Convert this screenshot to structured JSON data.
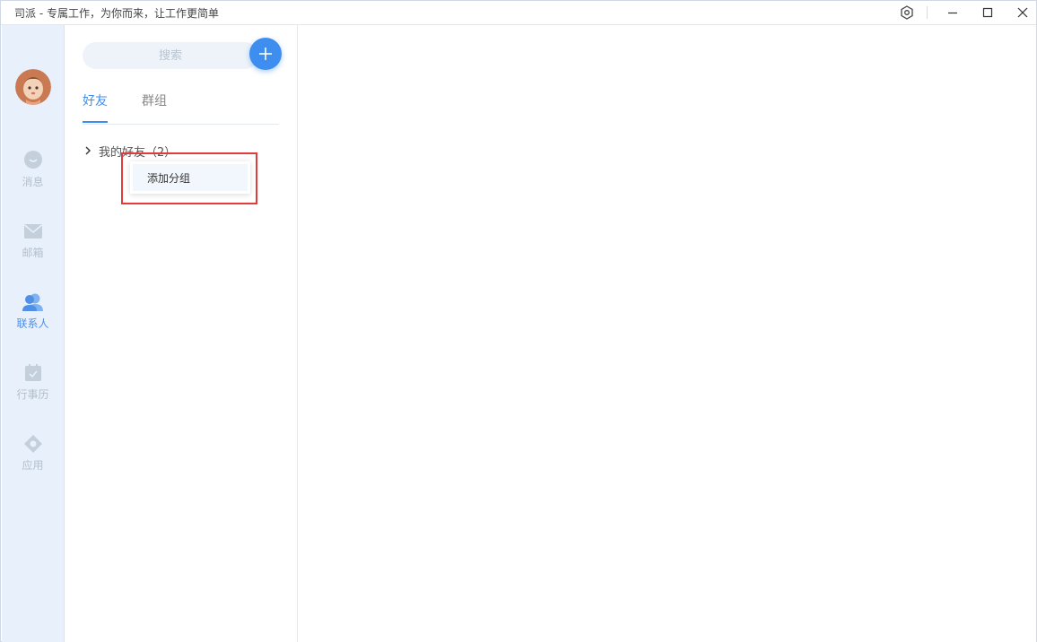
{
  "window": {
    "title": "司派 - 专属工作，为你而来，让工作更简单",
    "controls": [
      "settings-icon",
      "minimize-icon",
      "maximize-icon",
      "close-icon"
    ]
  },
  "rail": {
    "items": [
      {
        "label": "消息",
        "icon": "chat-bubble-icon",
        "active": false
      },
      {
        "label": "邮箱",
        "icon": "mail-icon",
        "active": false
      },
      {
        "label": "联系人",
        "icon": "contacts-icon",
        "active": true
      },
      {
        "label": "行事历",
        "icon": "calendar-icon",
        "active": false
      },
      {
        "label": "应用",
        "icon": "apps-icon",
        "active": false
      }
    ]
  },
  "panel": {
    "search_placeholder": "搜索",
    "tabs": [
      {
        "label": "好友",
        "active": true
      },
      {
        "label": "群组",
        "active": false
      }
    ],
    "group_label": "我的好友（2）"
  },
  "context_menu": {
    "items": [
      "添加分组"
    ]
  },
  "colors": {
    "accent": "#3e8ef0",
    "rail_bg": "#e8f1fb",
    "highlight": "#e23b3b"
  }
}
